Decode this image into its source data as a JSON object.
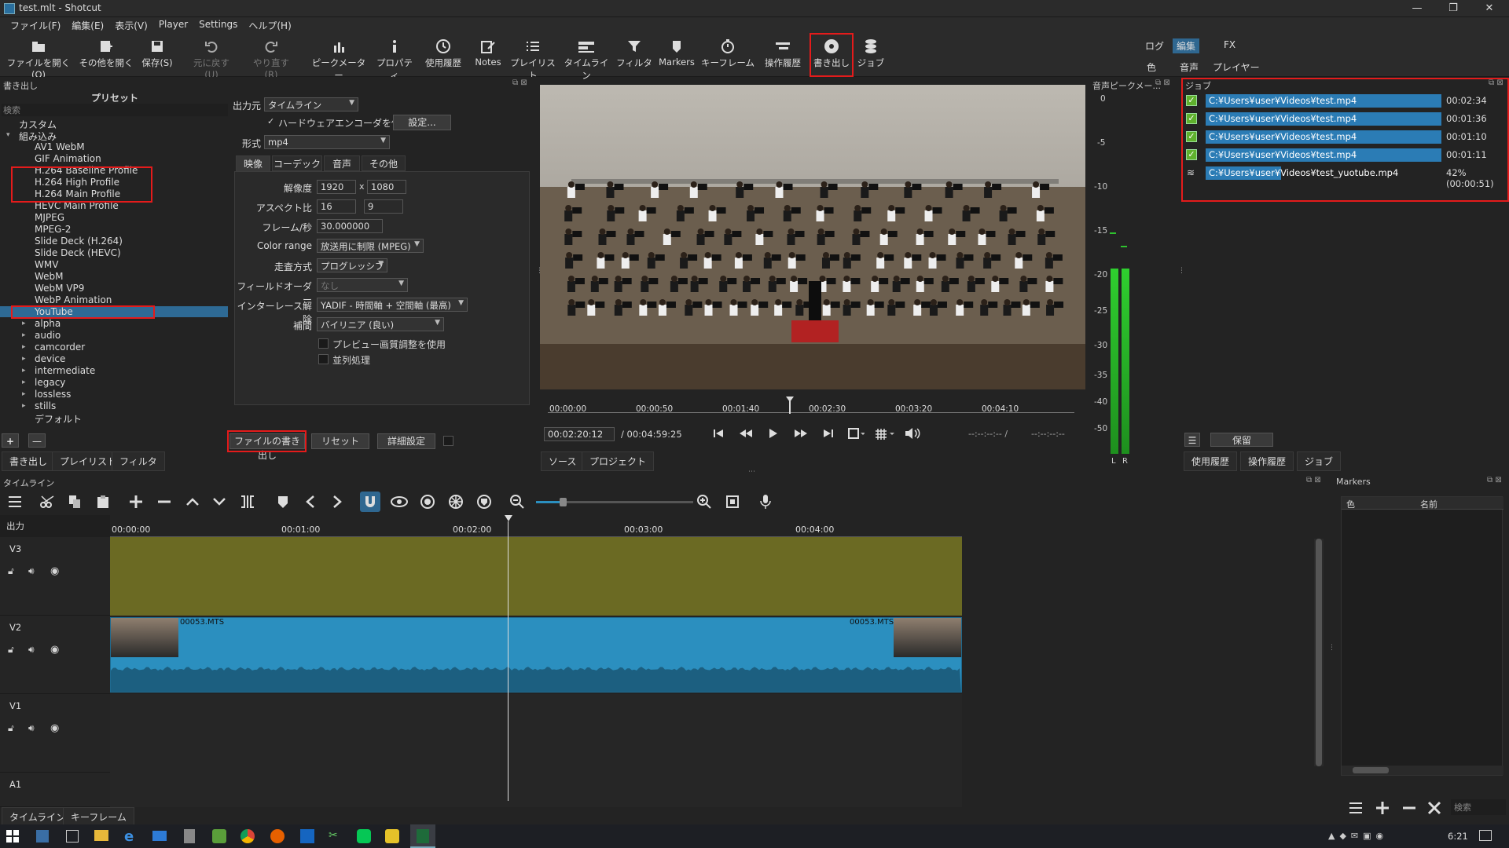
{
  "window": {
    "title": "test.mlt - Shotcut",
    "minimize": "—",
    "maximize": "❐",
    "close": "✕"
  },
  "menu": [
    "ファイル(F)",
    "編集(E)",
    "表示(V)",
    "Player",
    "Settings",
    "ヘルプ(H)"
  ],
  "toolbar": {
    "open": "ファイルを開く(O)",
    "open_other": "その他を開く",
    "save": "保存(S)",
    "undo": "元に戻す(U)",
    "redo": "やり直す(R)",
    "peak_meter": "ピークメーター",
    "properties": "プロパティ",
    "recent": "使用履歴",
    "notes": "Notes",
    "playlist": "プレイリスト",
    "timeline": "タイムライン",
    "filters": "フィルタ",
    "markers": "Markers",
    "keyframes": "キーフレーム",
    "history": "操作履歴",
    "export": "書き出し",
    "jobs": "ジョブ"
  },
  "layouts": {
    "log": "ログ",
    "edit": "編集",
    "fx": "FX",
    "color": "色",
    "audio": "音声",
    "player": "プレイヤー"
  },
  "export_panel": {
    "title": "書き出し",
    "presets_header": "プリセット",
    "search_placeholder": "検索",
    "custom": "カスタム",
    "builtin": "組み込み",
    "presets": [
      "AV1 WebM",
      "GIF Animation",
      "H.264 Baseline Profile",
      "H.264 High Profile",
      "H.264 Main Profile",
      "HEVC Main Profile",
      "MJPEG",
      "MPEG-2",
      "Slide Deck (H.264)",
      "Slide Deck (HEVC)",
      "WMV",
      "WebM",
      "WebM VP9",
      "WebP Animation",
      "YouTube"
    ],
    "groups": [
      "alpha",
      "audio",
      "camcorder",
      "device",
      "intermediate",
      "legacy",
      "lossless",
      "stills"
    ],
    "default": "デフォルト",
    "from_label": "出力元",
    "from_value": "タイムライン",
    "hw_encoder": "ハードウェアエンコーダを使用",
    "configure": "設定...",
    "format_label": "形式",
    "format_value": "mp4",
    "tabs": [
      "映像",
      "コーデック",
      "音声",
      "その他"
    ],
    "resolution_label": "解像度",
    "res_w": "1920",
    "res_x": "x",
    "res_h": "1080",
    "aspect_label": "アスペクト比",
    "aspect_w": "16",
    "aspect_h": "9",
    "fps_label": "フレーム/秒",
    "fps_value": "30.000000",
    "color_range_label": "Color range",
    "color_range_value": "放送用に制限 (MPEG)",
    "scan_label": "走査方式",
    "scan_value": "プログレッシブ",
    "field_order_label": "フィールドオーダー",
    "field_order_value": "なし",
    "deinterlace_label": "インターレース解除",
    "deinterlace_value": "YADIF - 時間軸 + 空間軸 (最高)",
    "interp_label": "補間",
    "interp_value": "バイリニア (良い)",
    "preview_scale": "プレビュー画質調整を使用",
    "parallel": "並列処理",
    "export_file_btn": "ファイルの書き出し",
    "reset_btn": "リセット",
    "advanced_btn": "詳細設定",
    "add": "+",
    "remove": "—"
  },
  "left_tabs": [
    "書き出し",
    "プレイリスト",
    "フィルタ"
  ],
  "player": {
    "ruler": [
      "00:00:00",
      "00:00:50",
      "00:01:40",
      "00:02:30",
      "00:03:20",
      "00:04:10"
    ],
    "timecode": "00:02:20:12",
    "duration": "/ 00:04:59:25",
    "in_out": "--:--:--:-- /",
    "out2": "--:--:--:--",
    "tabs": [
      "ソース",
      "プロジェクト"
    ]
  },
  "audio_meter": {
    "title": "音声ピークメー...",
    "scale": [
      "0",
      "-5",
      "-10",
      "-15",
      "-20",
      "-25",
      "-30",
      "-35",
      "-40",
      "-50"
    ],
    "left": "L",
    "right": "R"
  },
  "jobs": {
    "title": "ジョブ",
    "items": [
      {
        "path": "C:¥Users¥user¥Videos¥test.mp4",
        "time": "00:02:34"
      },
      {
        "path": "C:¥Users¥user¥Videos¥test.mp4",
        "time": "00:01:36"
      },
      {
        "path": "C:¥Users¥user¥Videos¥test.mp4",
        "time": "00:01:10"
      },
      {
        "path": "C:¥Users¥user¥Videos¥test.mp4",
        "time": "00:01:11"
      },
      {
        "path": "C:¥Users¥user¥Videos¥test_yuotube.mp4",
        "time": "42% (00:00:51)"
      }
    ],
    "hold_btn": "保留",
    "tabs": [
      "使用履歴",
      "操作履歴",
      "ジョブ"
    ]
  },
  "timeline": {
    "title": "タイムライン",
    "output": "出力",
    "ruler": [
      "00:00:00",
      "00:01:00",
      "00:02:00",
      "00:03:00",
      "00:04:00"
    ],
    "tracks": [
      "V3",
      "V2",
      "V1",
      "A1"
    ],
    "clip_name": "00053.MTS",
    "bottom_tabs": [
      "タイムライン",
      "キーフレーム"
    ]
  },
  "markers": {
    "title": "Markers",
    "col_color": "色",
    "col_name": "名前",
    "search_placeholder": "検索"
  },
  "taskbar": {
    "clock": "6:21"
  },
  "colors": {
    "accent": "#2f6790",
    "clip": "#2b8fbf",
    "v3_track": "#6b6a23",
    "highlight_red": "#e41b1b"
  }
}
